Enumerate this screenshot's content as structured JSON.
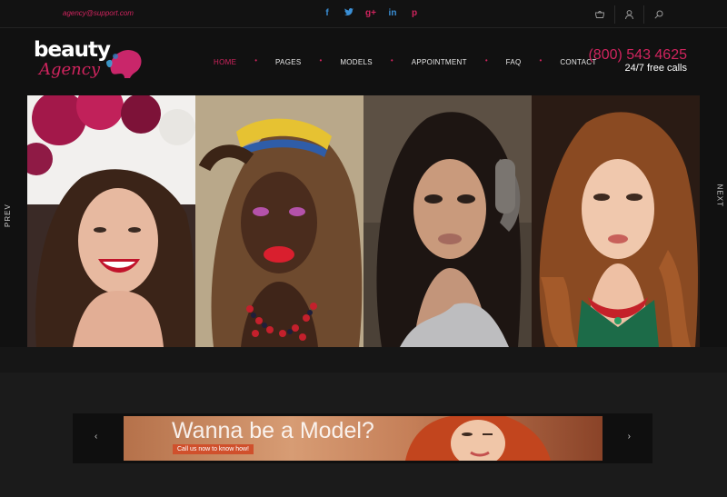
{
  "topbar": {
    "email": "agency@support.com",
    "socials": [
      {
        "name": "facebook-icon",
        "glyph": "f"
      },
      {
        "name": "twitter-icon",
        "glyph": "t"
      },
      {
        "name": "google-plus-icon",
        "glyph": "g+"
      },
      {
        "name": "linkedin-icon",
        "glyph": "in"
      },
      {
        "name": "pinterest-icon",
        "glyph": "p"
      }
    ],
    "icons": [
      "basket-icon",
      "user-icon",
      "search-icon"
    ]
  },
  "header": {
    "logo_word": "beauty",
    "logo_script": "Agency",
    "nav": [
      {
        "label": "HOME",
        "active": true
      },
      {
        "label": "PAGES",
        "active": false
      },
      {
        "label": "MODELS",
        "active": false
      },
      {
        "label": "APPOINTMENT",
        "active": false
      },
      {
        "label": "FAQ",
        "active": false
      },
      {
        "label": "CONTACT",
        "active": false
      }
    ],
    "phone": "(800) 543 4625",
    "phone_sub": "24/7 free calls"
  },
  "gallery": {
    "prev_label": "PREV",
    "next_label": "NEXT",
    "photos": [
      "model-photo-1",
      "model-photo-2",
      "model-photo-3",
      "model-photo-4"
    ]
  },
  "banner": {
    "title": "Wanna be a Model?",
    "cta": "Call us now to know how!",
    "left_arrow": "‹",
    "right_arrow": "›"
  },
  "colors": {
    "accent": "#d0245e",
    "background": "#111111",
    "social_blue": "#3a8fd6"
  }
}
